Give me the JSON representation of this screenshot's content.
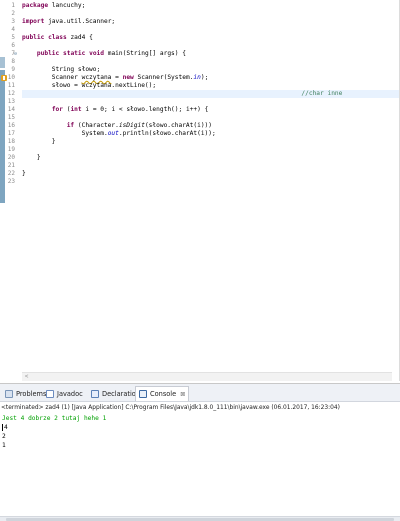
{
  "editor": {
    "lines": [
      {
        "num": "1",
        "tokens": [
          {
            "t": "package",
            "c": "kw"
          },
          {
            "t": " lancuchy;"
          }
        ]
      },
      {
        "num": "2",
        "tokens": []
      },
      {
        "num": "3",
        "tokens": [
          {
            "t": "import",
            "c": "kw"
          },
          {
            "t": " java.util.Scanner;"
          }
        ]
      },
      {
        "num": "4",
        "tokens": []
      },
      {
        "num": "5",
        "tokens": [
          {
            "t": "public",
            "c": "kw"
          },
          {
            "t": " "
          },
          {
            "t": "class",
            "c": "kw"
          },
          {
            "t": " zad4 {"
          }
        ]
      },
      {
        "num": "6",
        "tokens": []
      },
      {
        "num": "7",
        "fold": "⊖",
        "tokens": [
          {
            "t": "    "
          },
          {
            "t": "public",
            "c": "kw"
          },
          {
            "t": " "
          },
          {
            "t": "static",
            "c": "kw"
          },
          {
            "t": " "
          },
          {
            "t": "void",
            "c": "kw"
          },
          {
            "t": " main(String[] args) {"
          }
        ]
      },
      {
        "num": "8",
        "tokens": []
      },
      {
        "num": "9",
        "tokens": [
          {
            "t": "        String słowo;"
          }
        ]
      },
      {
        "num": "10",
        "warn": true,
        "tokens": [
          {
            "t": "        Scanner "
          },
          {
            "t": "wczytana",
            "c": "squig"
          },
          {
            "t": " = "
          },
          {
            "t": "new",
            "c": "kw"
          },
          {
            "t": " Scanner(System."
          },
          {
            "t": "in",
            "c": "fld"
          },
          {
            "t": ");"
          }
        ]
      },
      {
        "num": "11",
        "tokens": [
          {
            "t": "        słowo = wczytana.nextLine();"
          }
        ]
      },
      {
        "num": "12",
        "current": true,
        "tokens": [
          {
            "t": "                                                                           "
          },
          {
            "t": "//char inne",
            "c": "cm"
          }
        ]
      },
      {
        "num": "13",
        "tokens": []
      },
      {
        "num": "14",
        "tokens": [
          {
            "t": "        "
          },
          {
            "t": "for",
            "c": "kw"
          },
          {
            "t": " ("
          },
          {
            "t": "int",
            "c": "kw"
          },
          {
            "t": " i = 0; i < słowo.length(); i++) {"
          }
        ]
      },
      {
        "num": "15",
        "tokens": []
      },
      {
        "num": "16",
        "tokens": [
          {
            "t": "            "
          },
          {
            "t": "if",
            "c": "kw"
          },
          {
            "t": " (Character."
          },
          {
            "t": "isDigit",
            "c": "mth"
          },
          {
            "t": "(słowo.charAt(i)))"
          }
        ]
      },
      {
        "num": "17",
        "tokens": [
          {
            "t": "                System."
          },
          {
            "t": "out",
            "c": "fld"
          },
          {
            "t": ".println(słowo.charAt(i));"
          }
        ]
      },
      {
        "num": "18",
        "tokens": [
          {
            "t": "        }"
          }
        ]
      },
      {
        "num": "19",
        "tokens": []
      },
      {
        "num": "20",
        "tokens": [
          {
            "t": "    }"
          }
        ]
      },
      {
        "num": "21",
        "tokens": []
      },
      {
        "num": "22",
        "tokens": [
          {
            "t": "}"
          }
        ]
      },
      {
        "num": "23",
        "tokens": []
      }
    ],
    "scroll_arrow": "<"
  },
  "panel": {
    "tabs": [
      {
        "label": "Problems",
        "icon": "problems-icon",
        "active": false
      },
      {
        "label": "Javadoc",
        "icon": "javadoc-icon",
        "active": false
      },
      {
        "label": "Declaration",
        "icon": "declaration-icon",
        "active": false
      },
      {
        "label": "Console",
        "icon": "console-icon",
        "active": true,
        "close": "⊠"
      }
    ],
    "status": "<terminated> zad4 (1) [Java Application] C:\\Program Files\\Java\\jdk1.8.0_111\\bin\\javaw.exe (06.01.2017, 16:23:04)",
    "output": [
      {
        "text": "Jest 4 dobrze 2 tutaj hehe 1",
        "kind": "input"
      },
      {
        "text": "4",
        "kind": "output",
        "caret": true
      },
      {
        "text": "2",
        "kind": "output"
      },
      {
        "text": "1",
        "kind": "output"
      }
    ]
  },
  "colors": {
    "keyword": "#7f0055",
    "field": "#0000c0",
    "comment": "#3f7f5f",
    "console_input": "#00a000",
    "current_line": "#e8f2fe"
  }
}
